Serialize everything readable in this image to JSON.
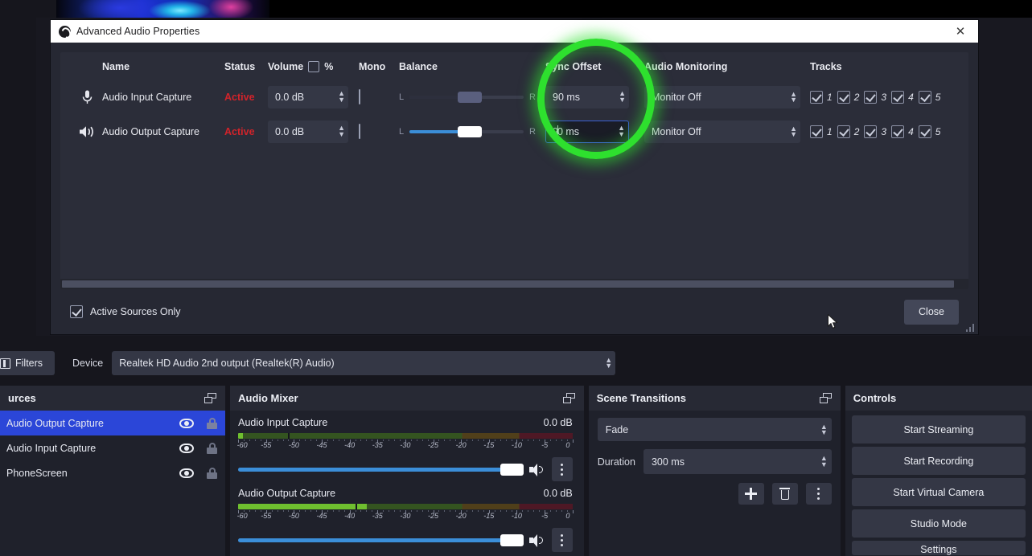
{
  "dialog": {
    "title": "Advanced Audio Properties",
    "close_x": "✕",
    "headers": {
      "name": "Name",
      "status": "Status",
      "volume": "Volume",
      "percent": "%",
      "mono": "Mono",
      "balance": "Balance",
      "sync_offset": "Sync Offset",
      "audio_monitoring": "Audio Monitoring",
      "tracks": "Tracks"
    },
    "rows": [
      {
        "icon": "microphone-icon",
        "name": "Audio Input Capture",
        "status": "Active",
        "volume": "0.0 dB",
        "mono": false,
        "balance_left_label": "L",
        "balance_right_label": "R",
        "sync_offset": "90 ms",
        "sync_focused": false,
        "monitoring": "Monitor Off",
        "tracks": [
          {
            "label": "1",
            "checked": true
          },
          {
            "label": "2",
            "checked": true
          },
          {
            "label": "3",
            "checked": true
          },
          {
            "label": "4",
            "checked": true
          },
          {
            "label": "5",
            "checked": true
          }
        ]
      },
      {
        "icon": "speaker-icon",
        "name": "Audio Output Capture",
        "status": "Active",
        "volume": "0.0 dB",
        "mono": false,
        "balance_left_label": "L",
        "balance_right_label": "R",
        "sync_offset_pre": "9",
        "sync_offset_post": "0 ms",
        "sync_offset": "90 ms",
        "sync_focused": true,
        "monitoring": "Monitor Off",
        "tracks": [
          {
            "label": "1",
            "checked": true
          },
          {
            "label": "2",
            "checked": true
          },
          {
            "label": "3",
            "checked": true
          },
          {
            "label": "4",
            "checked": true
          },
          {
            "label": "5",
            "checked": true
          }
        ]
      }
    ],
    "active_sources_only": "Active Sources Only",
    "active_sources_only_checked": true,
    "close_button": "Close",
    "highlight_color": "#2ee02e",
    "status_color": "#d2232a"
  },
  "toolbar": {
    "filters_button": "Filters",
    "device_label": "Device",
    "device_value": "Realtek HD Audio 2nd output (Realtek(R) Audio)"
  },
  "sources": {
    "title": "urces",
    "items": [
      {
        "name": "Audio Output Capture",
        "selected": true
      },
      {
        "name": "Audio Input Capture",
        "selected": false
      },
      {
        "name": "PhoneScreen",
        "selected": false
      }
    ]
  },
  "mixer": {
    "title": "Audio Mixer",
    "scale_ticks": [
      "-60",
      "-55",
      "-50",
      "-45",
      "-40",
      "-35",
      "-30",
      "-25",
      "-20",
      "-15",
      "-10",
      "-5",
      "0"
    ],
    "channels": [
      {
        "name": "Audio Input Capture",
        "db": "0.0 dB",
        "level_db": -59,
        "peak_db": -51,
        "volume_pct": 95
      },
      {
        "name": "Audio Output Capture",
        "db": "0.0 dB",
        "level_db": -37,
        "peak_db": -39,
        "volume_pct": 95
      }
    ]
  },
  "transitions": {
    "title": "Scene Transitions",
    "transition": "Fade",
    "duration_label": "Duration",
    "duration_value": "300 ms"
  },
  "controls": {
    "title": "Controls",
    "buttons": [
      "Start Streaming",
      "Start Recording",
      "Start Virtual Camera",
      "Studio Mode",
      "Settings"
    ]
  }
}
